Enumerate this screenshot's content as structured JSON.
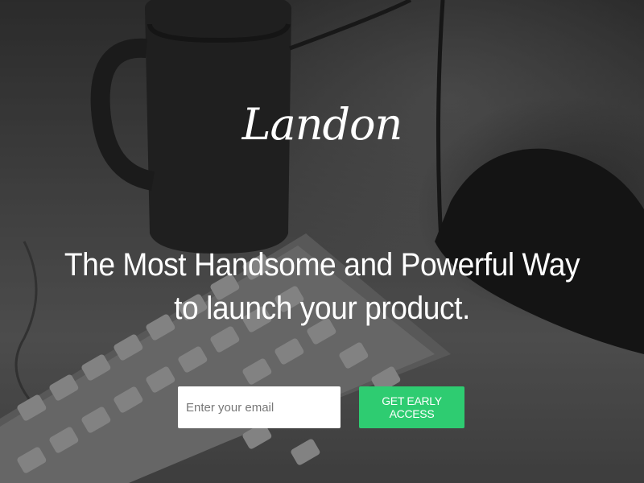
{
  "brand": {
    "logo_text": "Landon"
  },
  "hero": {
    "headline_line1": "The Most Handsome and Powerful Way",
    "headline_line2": "to launch your product.",
    "background_image": "monochrome desk photo with coffee mug, keyboard and hand on mouse"
  },
  "signup": {
    "email_placeholder": "Enter your email",
    "cta_label": "GET EARLY ACCESS"
  },
  "colors": {
    "accent": "#2ecc71",
    "text": "#ffffff",
    "input_bg": "#ffffff"
  }
}
